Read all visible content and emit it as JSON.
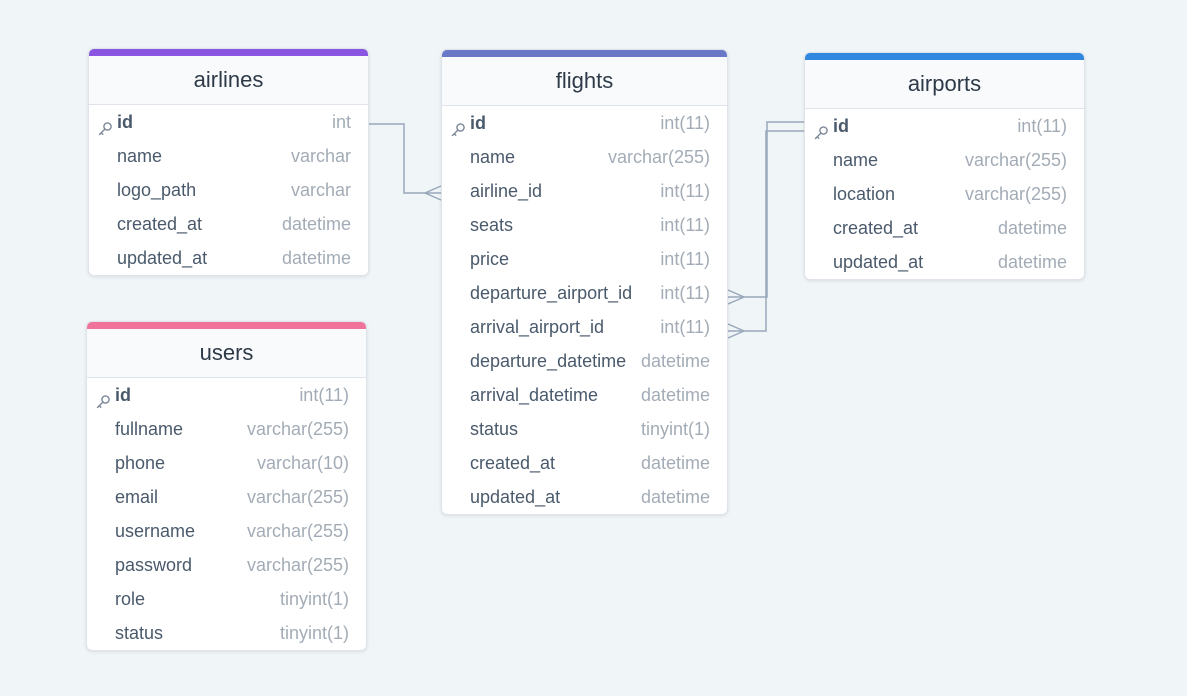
{
  "colors": {
    "airlines": "#8a55e0",
    "flights": "#6a78c8",
    "airports": "#2f87df",
    "users": "#f0739c",
    "connector": "#9aa8bb"
  },
  "tables": {
    "airlines": {
      "name": "airlines",
      "fields": [
        {
          "name": "id",
          "type": "int",
          "pk": true
        },
        {
          "name": "name",
          "type": "varchar"
        },
        {
          "name": "logo_path",
          "type": "varchar"
        },
        {
          "name": "created_at",
          "type": "datetime"
        },
        {
          "name": "updated_at",
          "type": "datetime"
        }
      ]
    },
    "flights": {
      "name": "flights",
      "fields": [
        {
          "name": "id",
          "type": "int(11)",
          "pk": true
        },
        {
          "name": "name",
          "type": "varchar(255)"
        },
        {
          "name": "airline_id",
          "type": "int(11)"
        },
        {
          "name": "seats",
          "type": "int(11)"
        },
        {
          "name": "price",
          "type": "int(11)"
        },
        {
          "name": "departure_airport_id",
          "type": "int(11)"
        },
        {
          "name": "arrival_airport_id",
          "type": "int(11)"
        },
        {
          "name": "departure_datetime",
          "type": "datetime"
        },
        {
          "name": "arrival_datetime",
          "type": "datetime"
        },
        {
          "name": "status",
          "type": "tinyint(1)"
        },
        {
          "name": "created_at",
          "type": "datetime"
        },
        {
          "name": "updated_at",
          "type": "datetime"
        }
      ]
    },
    "airports": {
      "name": "airports",
      "fields": [
        {
          "name": "id",
          "type": "int(11)",
          "pk": true
        },
        {
          "name": "name",
          "type": "varchar(255)"
        },
        {
          "name": "location",
          "type": "varchar(255)"
        },
        {
          "name": "created_at",
          "type": "datetime"
        },
        {
          "name": "updated_at",
          "type": "datetime"
        }
      ]
    },
    "users": {
      "name": "users",
      "fields": [
        {
          "name": "id",
          "type": "int(11)",
          "pk": true
        },
        {
          "name": "fullname",
          "type": "varchar(255)"
        },
        {
          "name": "phone",
          "type": "varchar(10)"
        },
        {
          "name": "email",
          "type": "varchar(255)"
        },
        {
          "name": "username",
          "type": "varchar(255)"
        },
        {
          "name": "password",
          "type": "varchar(255)"
        },
        {
          "name": "role",
          "type": "tinyint(1)"
        },
        {
          "name": "status",
          "type": "tinyint(1)"
        }
      ]
    }
  },
  "relations": [
    {
      "from": "airlines.id",
      "to": "flights.airline_id",
      "cardinality": "one-to-many"
    },
    {
      "from": "airports.id",
      "to": "flights.departure_airport_id",
      "cardinality": "one-to-many"
    },
    {
      "from": "airports.id",
      "to": "flights.arrival_airport_id",
      "cardinality": "one-to-many"
    }
  ]
}
